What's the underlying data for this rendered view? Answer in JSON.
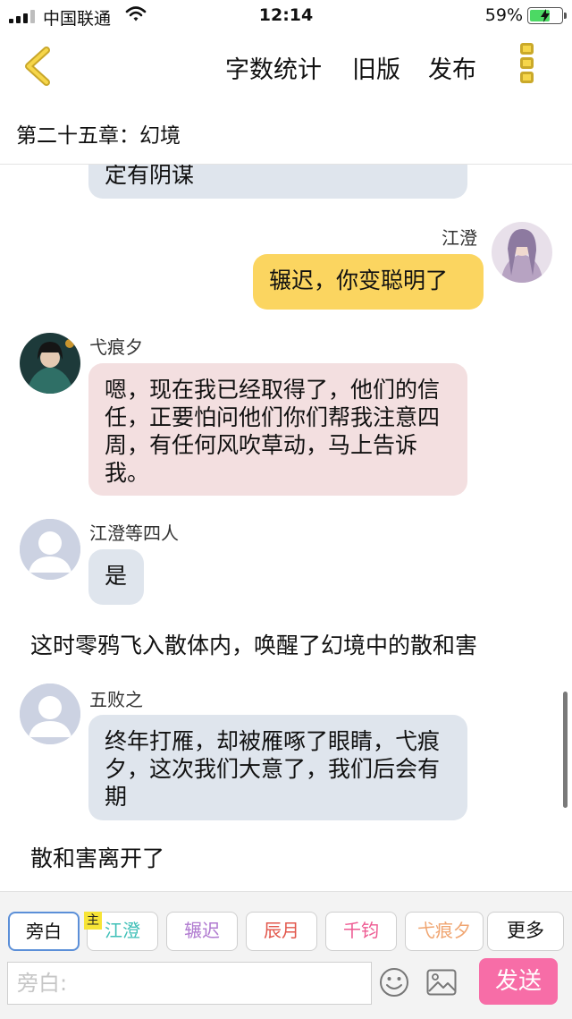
{
  "status_bar": {
    "carrier": "中国联通",
    "time": "12:14",
    "battery": "59%",
    "battery_level": 0.59
  },
  "nav": {
    "back_icon": "chevron-left-icon",
    "word_count": "字数统计",
    "old_version": "旧版",
    "publish": "发布",
    "more_icon": "menu-icon",
    "accent_color": "#f6d64a"
  },
  "chapter": {
    "title": "第二十五章：幻境"
  },
  "messages": {
    "partial": {
      "text": "定有阴谋"
    },
    "m1": {
      "name": "江澄",
      "text": "辗迟，你变聪明了"
    },
    "m2": {
      "name": "弋痕夕",
      "text": "嗯，现在我已经取得了，他们的信任，正要怕问他们你们帮我注意四周，有任何风吹草动，马上告诉我。"
    },
    "m3": {
      "name": "江澄等四人",
      "text": "是"
    },
    "narration1": "这时零鸦飞入散体内，唤醒了幻境中的散和害",
    "m4": {
      "name": "五败之",
      "text": "终年打雁，却被雁啄了眼睛，弋痕夕，这次我们大意了，我们后会有期"
    },
    "narration2": "散和害离开了"
  },
  "roles": {
    "narrator": "旁白",
    "main_badge": "主",
    "jiangcheng": "江澄",
    "zhanchi": "辗迟",
    "chenyue": "辰月",
    "qianjun": "千钧",
    "yihenxi": "弋痕夕",
    "more": "更多"
  },
  "input": {
    "placeholder": "旁白:",
    "send": "发送",
    "send_color": "#f76da7"
  }
}
